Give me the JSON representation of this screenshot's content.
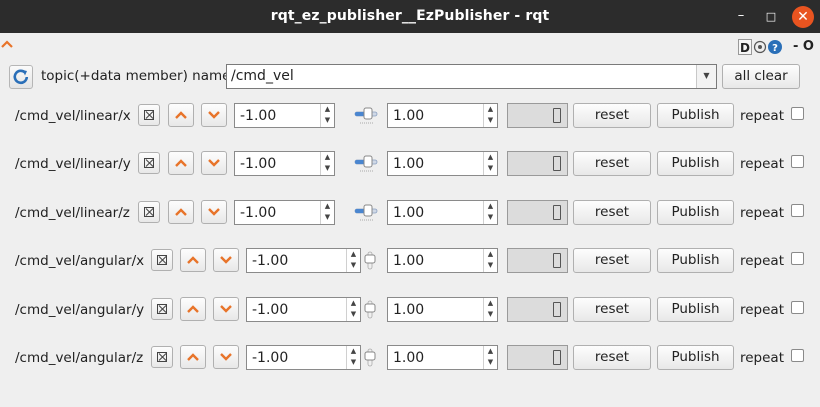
{
  "window": {
    "title": "rqt_ez_publisher__EzPublisher - rqt",
    "minimize_glyph": "–",
    "maximize_glyph": "□",
    "close_glyph": "✕"
  },
  "dock": {
    "d_label": "D",
    "o_label": "- O"
  },
  "topic": {
    "label": "topic(+data member) name",
    "value": "/cmd_vel",
    "all_clear_label": "all clear"
  },
  "rows": [
    {
      "name": "/cmd_vel/linear/x",
      "min": "-1.00",
      "max": "1.00",
      "reset": "reset",
      "publish": "Publish",
      "repeat": "repeat",
      "slider": "horizontal"
    },
    {
      "name": "/cmd_vel/linear/y",
      "min": "-1.00",
      "max": "1.00",
      "reset": "reset",
      "publish": "Publish",
      "repeat": "repeat",
      "slider": "horizontal"
    },
    {
      "name": "/cmd_vel/linear/z",
      "min": "-1.00",
      "max": "1.00",
      "reset": "reset",
      "publish": "Publish",
      "repeat": "repeat",
      "slider": "horizontal"
    },
    {
      "name": "/cmd_vel/angular/x",
      "min": "-1.00",
      "max": "1.00",
      "reset": "reset",
      "publish": "Publish",
      "repeat": "repeat",
      "slider": "vertical"
    },
    {
      "name": "/cmd_vel/angular/y",
      "min": "-1.00",
      "max": "1.00",
      "reset": "reset",
      "publish": "Publish",
      "repeat": "repeat",
      "slider": "vertical"
    },
    {
      "name": "/cmd_vel/angular/z",
      "min": "-1.00",
      "max": "1.00",
      "reset": "reset",
      "publish": "Publish",
      "repeat": "repeat",
      "slider": "vertical"
    }
  ],
  "colors": {
    "accent": "#e95420",
    "titlebar": "#2c2c2c",
    "arrow": "#e8742a",
    "refresh": "#2a6fb8"
  }
}
